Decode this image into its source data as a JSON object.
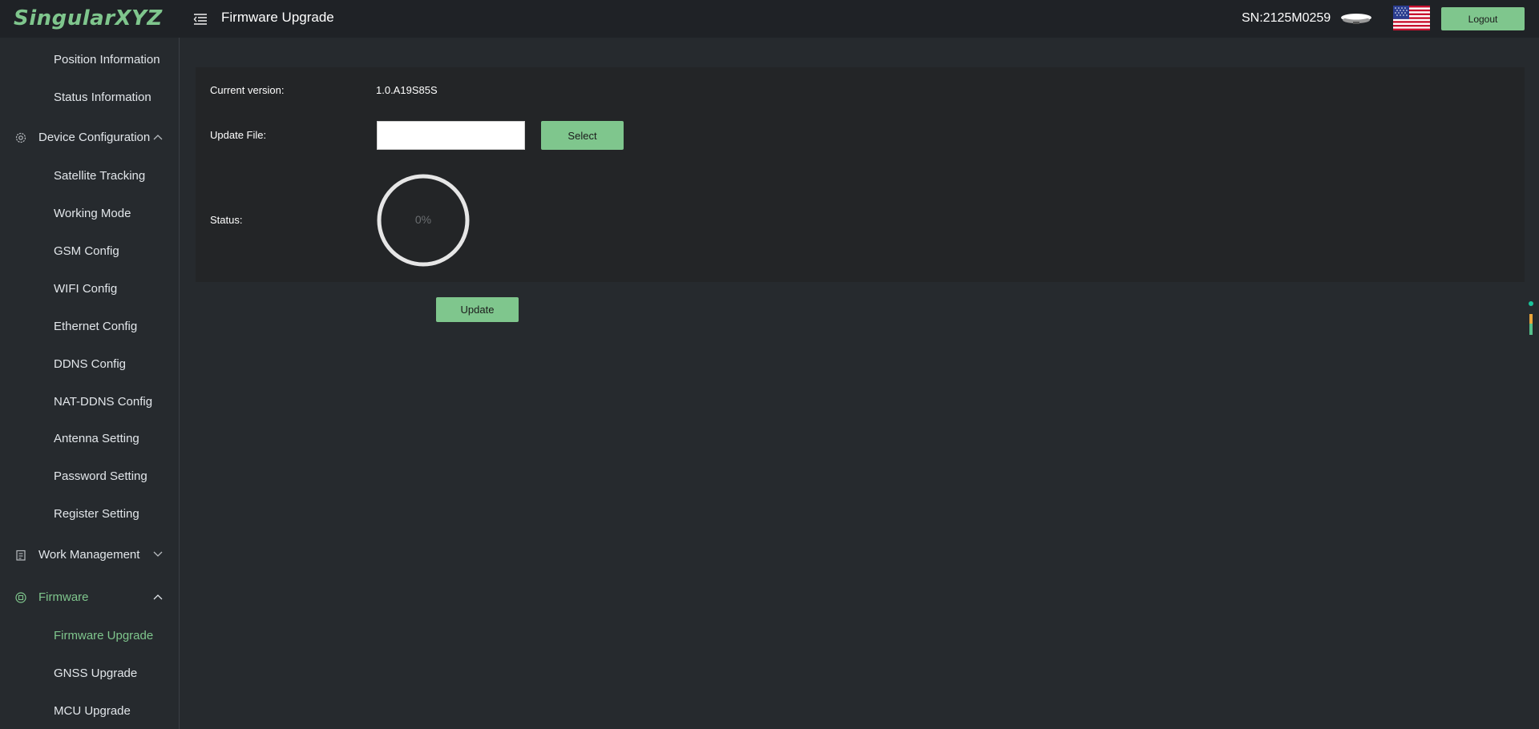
{
  "header": {
    "logo": "SingularXYZ",
    "title": "Firmware Upgrade",
    "serial": "SN:2125M0259",
    "logout_label": "Logout"
  },
  "sidebar": {
    "items_top": [
      {
        "label": "Position Information"
      },
      {
        "label": "Status Information"
      }
    ],
    "groups": [
      {
        "label": "Device Configuration",
        "icon": "gear-icon",
        "expanded": true,
        "items": [
          {
            "label": "Satellite Tracking"
          },
          {
            "label": "Working Mode"
          },
          {
            "label": "GSM Config"
          },
          {
            "label": "WIFI Config"
          },
          {
            "label": "Ethernet Config"
          },
          {
            "label": "DDNS Config"
          },
          {
            "label": "NAT-DDNS Config"
          },
          {
            "label": "Antenna Setting"
          },
          {
            "label": "Password Setting"
          },
          {
            "label": "Register Setting"
          }
        ]
      },
      {
        "label": "Work Management",
        "icon": "clipboard-icon",
        "expanded": false,
        "items": []
      },
      {
        "label": "Firmware",
        "icon": "chip-icon",
        "expanded": true,
        "active": true,
        "items": [
          {
            "label": "Firmware Upgrade",
            "active": true
          },
          {
            "label": "GNSS Upgrade"
          },
          {
            "label": "MCU Upgrade"
          }
        ]
      }
    ]
  },
  "main": {
    "current_version_label": "Current version:",
    "current_version_value": "1.0.A19S85S",
    "update_file_label": "Update File:",
    "update_file_value": "",
    "select_label": "Select",
    "status_label": "Status:",
    "progress_percent": 0,
    "progress_text": "0%",
    "update_label": "Update"
  },
  "colors": {
    "accent": "#7fc68d",
    "background": "#262a2e",
    "header": "#1f2226",
    "panel": "#232527"
  }
}
